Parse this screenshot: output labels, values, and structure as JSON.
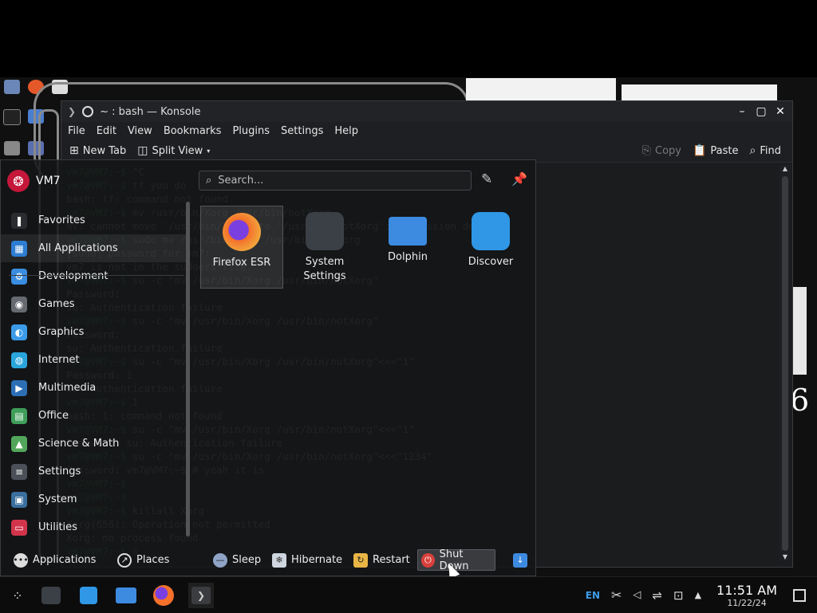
{
  "konsole": {
    "title": "~ : bash — Konsole",
    "menu": [
      "File",
      "Edit",
      "View",
      "Bookmarks",
      "Plugins",
      "Settings",
      "Help"
    ],
    "toolbar": {
      "new_tab": "New Tab",
      "split_view": "Split View",
      "copy": "Copy",
      "paste": "Paste",
      "find": "Find"
    },
    "terminal_lines": [
      {
        "p": "vm7@VM7:~$",
        "t": " ^C"
      },
      {
        "p": "vm7@VM7:~$",
        "t": " tf you do"
      },
      {
        "p": "",
        "t": "bash: tf: command not found"
      },
      {
        "p": "vm7@VM7:~$",
        "t": " mv /usr/bin/Xorg /usr/bin/notXorg"
      },
      {
        "p": "",
        "t": "mv: cannot move '/usr/bin/Xorg' to '/usr/bin/notXorg': Permission denied"
      },
      {
        "p": "vm7@VM7:~$",
        "t": " sudo mv /usr/bin/Xorg /usr/bin/notXorg"
      },
      {
        "p": "",
        "t": "[sudo] password for vm7:"
      },
      {
        "p": "",
        "t": "vm7 is not in the sudoers file."
      },
      {
        "p": "vm7@VM7:~$",
        "t": " su -c \"mv /usr/bin/Xorg /usr/bin/notXorg\""
      },
      {
        "p": "",
        "t": "Password:"
      },
      {
        "p": "",
        "t": "su: Authentication failure"
      },
      {
        "p": "vm7@VM7:~$",
        "t": " su -c \"mv /usr/bin/Xorg /usr/bin/notXorg\""
      },
      {
        "p": "",
        "t": "Password:"
      },
      {
        "p": "",
        "t": "su: Authentication failure"
      },
      {
        "p": "vm7@VM7:~$",
        "t": " su -c \"mv /usr/bin/Xorg /usr/bin/notXorg\"<<<\"1\""
      },
      {
        "p": "",
        "t": "Password: 1"
      },
      {
        "p": "",
        "t": "su: Authentication failure"
      },
      {
        "p": "vm7@VM7:~$",
        "t": " 1"
      },
      {
        "p": "",
        "t": "bash: 1: command not found"
      },
      {
        "p": "vm7@VM7:~$",
        "t": " su -c \"mv /usr/bin/Xorg /usr/bin/notXorg\"<<<\"1\""
      },
      {
        "p": "",
        "t": "Password: su: Authentication failure"
      },
      {
        "p": "vm7@VM7:~$",
        "t": " su -c \"mv /usr/bin/Xorg /usr/bin/notXorg\"<<<\"1234\""
      },
      {
        "p": "",
        "t": "Password: vm7@VM7:~$ # yeah it is"
      },
      {
        "p": "vm7@VM7:~$",
        "t": ""
      },
      {
        "p": "vm7@VM7:~$",
        "t": ""
      },
      {
        "p": "vm7@VM7:~$",
        "t": " killall Xorg"
      },
      {
        "p": "",
        "t": "Xorg(656): Operation not permitted"
      },
      {
        "p": "",
        "t": "Xorg: no process found"
      },
      {
        "p": "vm7@VM7:~$",
        "t": " ▯"
      }
    ]
  },
  "launcher": {
    "user": "VM7",
    "search_placeholder": "Search...",
    "categories": [
      {
        "label": "Favorites",
        "icon": "bookmark-icon",
        "color": "#2b2c30"
      },
      {
        "label": "All Applications",
        "icon": "grid-icon",
        "color": "#2d7dd2"
      },
      {
        "label": "Development",
        "icon": "development-icon",
        "color": "#3a8de0"
      },
      {
        "label": "Games",
        "icon": "gamepad-icon",
        "color": "#666a70"
      },
      {
        "label": "Graphics",
        "icon": "graphics-icon",
        "color": "#3b9be8"
      },
      {
        "label": "Internet",
        "icon": "globe-icon",
        "color": "#2aa5dc"
      },
      {
        "label": "Multimedia",
        "icon": "multimedia-icon",
        "color": "#2c6fb5"
      },
      {
        "label": "Office",
        "icon": "office-icon",
        "color": "#3f9e5a"
      },
      {
        "label": "Science & Math",
        "icon": "science-icon",
        "color": "#52a65b"
      },
      {
        "label": "Settings",
        "icon": "settings-icon",
        "color": "#4b5058"
      },
      {
        "label": "System",
        "icon": "system-icon",
        "color": "#3a6f9e"
      },
      {
        "label": "Utilities",
        "icon": "utilities-icon",
        "color": "#d2354b"
      }
    ],
    "favorites": [
      {
        "label": "Firefox ESR",
        "icon": "firefox-icon",
        "color": "#f4702b"
      },
      {
        "label": "System Settings",
        "icon": "system-settings-icon",
        "color": "#3b3f46"
      },
      {
        "label": "Dolphin",
        "icon": "folder-icon",
        "color": "#3d8be0"
      },
      {
        "label": "Discover",
        "icon": "discover-icon",
        "color": "#2f97e6"
      }
    ],
    "footer": {
      "applications": "Applications",
      "places": "Places",
      "sleep": "Sleep",
      "hibernate": "Hibernate",
      "restart": "Restart",
      "shutdown": "Shut Down"
    }
  },
  "taskbar": {
    "keyboard_layout": "EN",
    "time": "11:51 AM",
    "date": "11/22/24"
  },
  "desktop": {
    "big_text": "6"
  }
}
